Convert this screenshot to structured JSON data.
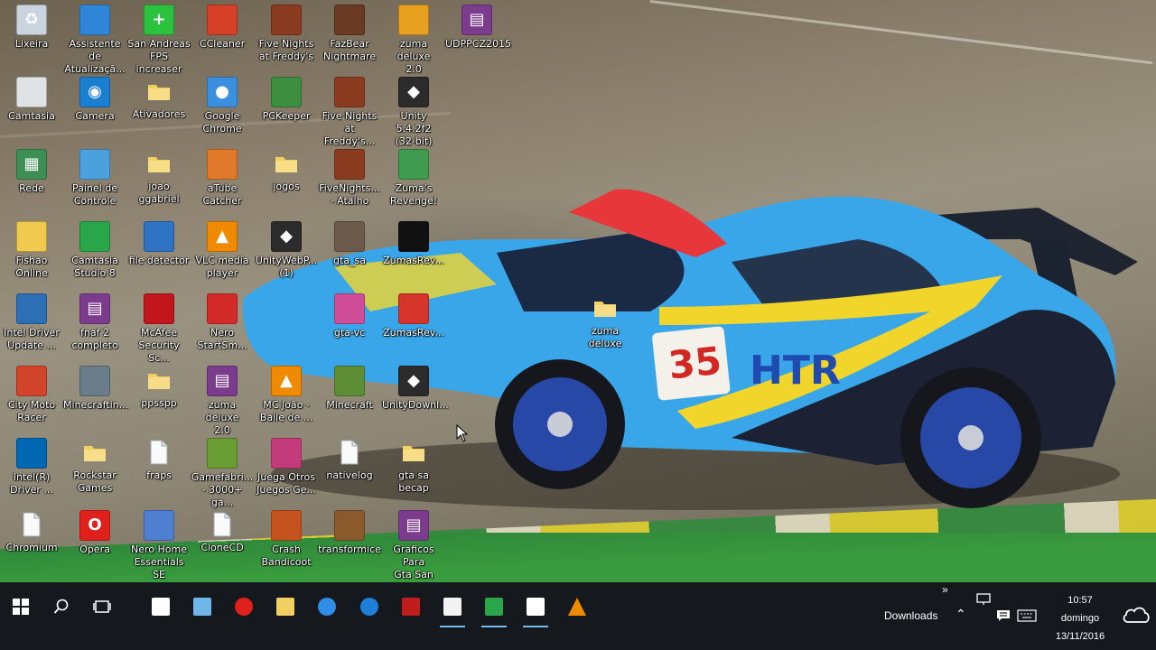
{
  "desktop": {
    "icons": [
      {
        "label": "Lixeira",
        "icon": "recycle-bin-icon",
        "color": "#c9d4df"
      },
      {
        "label": "Camtasia",
        "icon": "camtasia-icon",
        "color": "#dfe3e6"
      },
      {
        "label": "Rede",
        "icon": "network-icon",
        "color": "#3e8f53"
      },
      {
        "label": "Fishao\nOnline",
        "icon": "fishao-icon",
        "color": "#f0c94e"
      },
      {
        "label": "Intel Driver\nUpdate ...",
        "icon": "intel-driver-icon",
        "color": "#2d6fb5"
      },
      {
        "label": "City Moto\nRacer",
        "icon": "city-moto-icon",
        "color": "#d2452b"
      },
      {
        "label": "Intel(R)\nDriver ...",
        "icon": "intel-icon",
        "color": "#0067b2"
      },
      {
        "label": "Chromium",
        "icon": "chromium-file-icon",
        "color": "#f2f2f2"
      },
      {
        "label": "Assistente de\nAtualizaçã...",
        "icon": "windows-update-icon",
        "color": "#2f86d8"
      },
      {
        "label": "Camera",
        "icon": "camera-icon",
        "color": "#1a7fd1"
      },
      {
        "label": "Painel de\nControle",
        "icon": "control-panel-icon",
        "color": "#4aa1de"
      },
      {
        "label": "Camtasia\nStudio 8",
        "icon": "camtasia-studio-icon",
        "color": "#2aa64a"
      },
      {
        "label": "fnaf 2\ncompleto",
        "icon": "winrar-icon",
        "color": "#7b3c8e"
      },
      {
        "label": "Minecraftin...",
        "icon": "minecraft-installer-icon",
        "color": "#6b7c8a"
      },
      {
        "label": "Rockstar\nGames",
        "icon": "folder-icon",
        "color": "#f1cf60"
      },
      {
        "label": "Opera",
        "icon": "opera-icon",
        "color": "#e0201b"
      },
      {
        "label": "San Andreas\nFPS increaser",
        "icon": "plus-icon",
        "color": "#2bc23d"
      },
      {
        "label": "Ativadores",
        "icon": "folder-icon",
        "color": "#f1cf60"
      },
      {
        "label": "joao ggabriel",
        "icon": "folder-icon",
        "color": "#f1cf60"
      },
      {
        "label": "file detector",
        "icon": "file-detector-icon",
        "color": "#2e73c4"
      },
      {
        "label": "McAfee\nSecurity Sc...",
        "icon": "mcafee-icon",
        "color": "#c3161c"
      },
      {
        "label": "ppsspp",
        "icon": "folder-icon",
        "color": "#f1cf60"
      },
      {
        "label": "fraps",
        "icon": "file-icon",
        "color": "#f2f2f2"
      },
      {
        "label": "Nero Home\nEssentials SE",
        "icon": "nero-home-icon",
        "color": "#4f7fd0"
      },
      {
        "label": "CCleaner",
        "icon": "ccleaner-icon",
        "color": "#d64027"
      },
      {
        "label": "Google\nChrome",
        "icon": "chrome-icon",
        "color": "#3a8fde"
      },
      {
        "label": "aTube\nCatcher",
        "icon": "atube-icon",
        "color": "#e0792a"
      },
      {
        "label": "VLC media\nplayer",
        "icon": "vlc-icon",
        "color": "#f08a00"
      },
      {
        "label": "Nero\nStartSm...",
        "icon": "nero-icon",
        "color": "#d42a2a"
      },
      {
        "label": "zuma deluxe\n2.0",
        "icon": "winrar-icon",
        "color": "#7b3c8e"
      },
      {
        "label": "Gamefabri...\n- 3000+ ga...",
        "icon": "gamefabrique-icon",
        "color": "#6a9d34"
      },
      {
        "label": "CloneCD",
        "icon": "file-icon",
        "color": "#f2f2f2"
      },
      {
        "label": "Five Nights\nat Freddy's",
        "icon": "fnaf-icon",
        "color": "#8b3b20"
      },
      {
        "label": "PCKeeper",
        "icon": "pckeeper-icon",
        "color": "#3d8e3f"
      },
      {
        "label": "jogos",
        "icon": "folder-icon",
        "color": "#f1cf60"
      },
      {
        "label": "UnityWebP...\n(1)",
        "icon": "unity-icon",
        "color": "#2b2b2b"
      },
      {
        "label": "MC João -\nBaile de ...",
        "icon": "vlc-icon",
        "color": "#f08a00"
      },
      {
        "label": "Juega Otros\nJuegos Ge...",
        "icon": "juega-icon",
        "color": "#c23b7a"
      },
      {
        "label": "Crash\nBandicoot",
        "icon": "crash-icon",
        "color": "#c4531f"
      },
      {
        "label": "FazBear\nNightmare",
        "icon": "fazbear-icon",
        "color": "#6b3a22"
      },
      {
        "label": "Five Nights\nat Freddy's...",
        "icon": "fnaf-icon",
        "color": "#8b3b20"
      },
      {
        "label": "FiveNights...\n- Atalho",
        "icon": "fnaf-icon",
        "color": "#8b3b20"
      },
      {
        "label": "gta_sa",
        "icon": "gta-sa-icon",
        "color": "#6c5b4a"
      },
      {
        "label": "gta-vc",
        "icon": "gta-vc-icon",
        "color": "#d04d9a"
      },
      {
        "label": "Minecraft",
        "icon": "minecraft-icon",
        "color": "#5d8d34"
      },
      {
        "label": "nativelog",
        "icon": "file-icon",
        "color": "#f2f2f2"
      },
      {
        "label": "transformice",
        "icon": "transformice-icon",
        "color": "#8a5a2c"
      },
      {
        "label": "zuma deluxe\n2.0",
        "icon": "zuma-icon",
        "color": "#e8a020"
      },
      {
        "label": "Unity 5.4.2f2\n(32-bit)",
        "icon": "unity-icon",
        "color": "#2b2b2b"
      },
      {
        "label": "Zuma's\nRevenge!",
        "icon": "zumas-revenge-icon",
        "color": "#3f9b4e"
      },
      {
        "label": "ZumasRev...",
        "icon": "zumas-rev-icon",
        "color": "#111111"
      },
      {
        "label": "ZumasRev...",
        "icon": "zumas-rev2-icon",
        "color": "#d5352b"
      },
      {
        "label": "UnityDownl...",
        "icon": "unity-icon",
        "color": "#2b2b2b"
      },
      {
        "label": "gta sa becap",
        "icon": "folder-icon",
        "color": "#f1cf60"
      },
      {
        "label": "Graficos Para\nGta San An...",
        "icon": "winrar-icon",
        "color": "#7b3c8e"
      },
      {
        "label": "UDPPCZ2015",
        "icon": "winrar-icon",
        "color": "#7b3c8e"
      },
      {
        "label": "zuma deluxe",
        "icon": "folder-icon",
        "color": "#f1cf60"
      }
    ]
  },
  "taskbar": {
    "start": "windows-start-icon",
    "search": "search-icon",
    "task_view": "task-view-icon",
    "pinned": [
      {
        "name": "store-icon",
        "color": "#ffffff"
      },
      {
        "name": "wave-app-icon",
        "color": "#6fb7e8"
      },
      {
        "name": "opera-icon",
        "color": "#e0201b"
      },
      {
        "name": "file-explorer-icon",
        "color": "#f1cf60"
      },
      {
        "name": "internet-explorer-icon",
        "color": "#2d8ee4"
      },
      {
        "name": "edge-icon",
        "color": "#1e7fd8"
      },
      {
        "name": "video-recorder-icon",
        "color": "#c21d1d"
      },
      {
        "name": "file-editor-icon",
        "color": "#f2f2f2"
      },
      {
        "name": "camtasia-studio-icon",
        "color": "#2aa64a"
      },
      {
        "name": "camtasia-recorder-icon",
        "color": "#ffffff"
      },
      {
        "name": "vlc-icon",
        "color": "#f08a00"
      }
    ],
    "downloads_label": "Downloads",
    "time": "10:57",
    "day": "domingo",
    "date": "13/11/2016"
  }
}
